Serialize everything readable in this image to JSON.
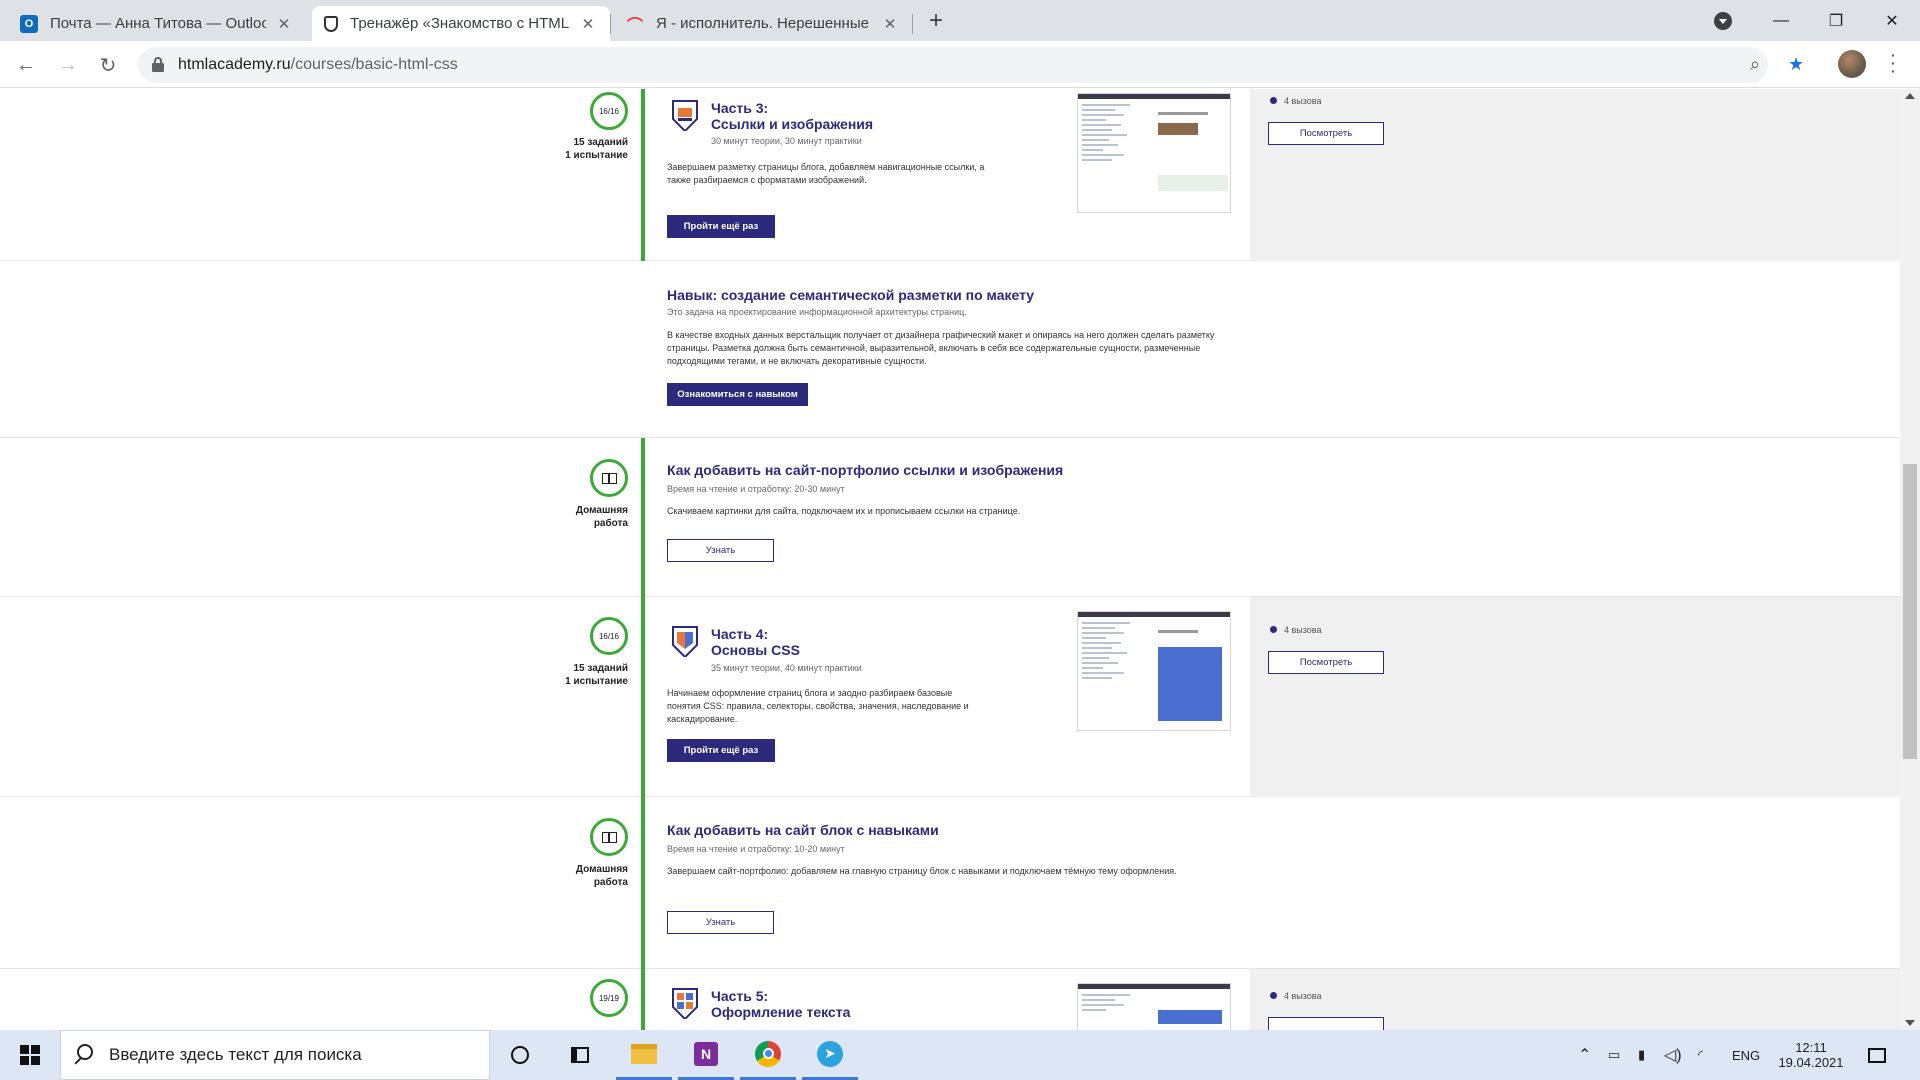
{
  "browser": {
    "tabs": [
      {
        "title": "Почта — Анна Титова — Outlook",
        "icon": "outlook-icon",
        "active": false
      },
      {
        "title": "Тренажёр «Знакомство с HTML",
        "icon": "htmlacademy-icon",
        "active": true
      },
      {
        "title": "Я - исполнитель. Нерешенные",
        "icon": "yandex-icon",
        "active": false
      }
    ],
    "url_host": "htmlacademy.ru",
    "url_path": "/courses/basic-html-css"
  },
  "sections": {
    "part3": {
      "node_label": "16/16",
      "tasks": "15 заданий",
      "tests": "1 испытание",
      "part": "Часть 3:",
      "title": "Ссылки и изображения",
      "time": "30 минут теории, 30 минут практики",
      "description": "Завершаем разметку страницы блога, добавляем навигационные ссылки, а также разбираемся с форматами изображений.",
      "button": "Пройти ещё раз",
      "calls": "4 вызова",
      "view_button": "Посмотреть"
    },
    "skill": {
      "title": "Навык: создание семантической разметки по макету",
      "subtitle": "Это задача на проектирование информационной архитектуры страниц.",
      "description": "В качестве входных данных верстальщик получает от дизайнера графический макет и опираясь на него должен сделать разметку страницы. Разметка должна быть семантичной, выразительной, включать в себя все содержательные сущности, размеченные подходящими тегами, и не включать декоративные сущности.",
      "button": "Ознакомиться с навыком"
    },
    "homework1": {
      "label_line1": "Домашняя",
      "label_line2": "работа",
      "title": "Как добавить на сайт-портфолио ссылки и изображения",
      "time": "Время на чтение и отработку: 20-30 минут",
      "description": "Скачиваем картинки для сайта, подключаем их и прописываем ссылки на странице.",
      "button": "Узнать"
    },
    "part4": {
      "node_label": "16/16",
      "tasks": "15 заданий",
      "tests": "1 испытание",
      "part": "Часть 4:",
      "title": "Основы CSS",
      "time": "35 минут теории, 40 минут практики",
      "description": "Начинаем оформление страниц блога и заодно разбираем базовые понятия CSS: правила, селекторы, свойства, значения, наследование и каскадирование.",
      "button": "Пройти ещё раз",
      "calls": "4 вызова",
      "view_button": "Посмотреть"
    },
    "homework2": {
      "label_line1": "Домашняя",
      "label_line2": "работа",
      "title": "Как добавить на сайт блок с навыками",
      "time": "Время на чтение и отработку: 10-20 минут",
      "description": "Завершаем сайт-портфолио: добавляем на главную страницу блок с навыками и подключаем тёмную тему оформления.",
      "button": "Узнать"
    },
    "part5": {
      "node_label": "19/19",
      "part": "Часть 5:",
      "title": "Оформление текста",
      "calls": "4 вызова"
    }
  },
  "taskbar": {
    "search_placeholder": "Введите здесь текст для поиска",
    "lang": "ENG",
    "time": "12:11",
    "date": "19.04.2021"
  },
  "colors": {
    "accent": "#2c2a7c",
    "timeline": "#3aaa35",
    "panel": "#f0f0f0"
  }
}
